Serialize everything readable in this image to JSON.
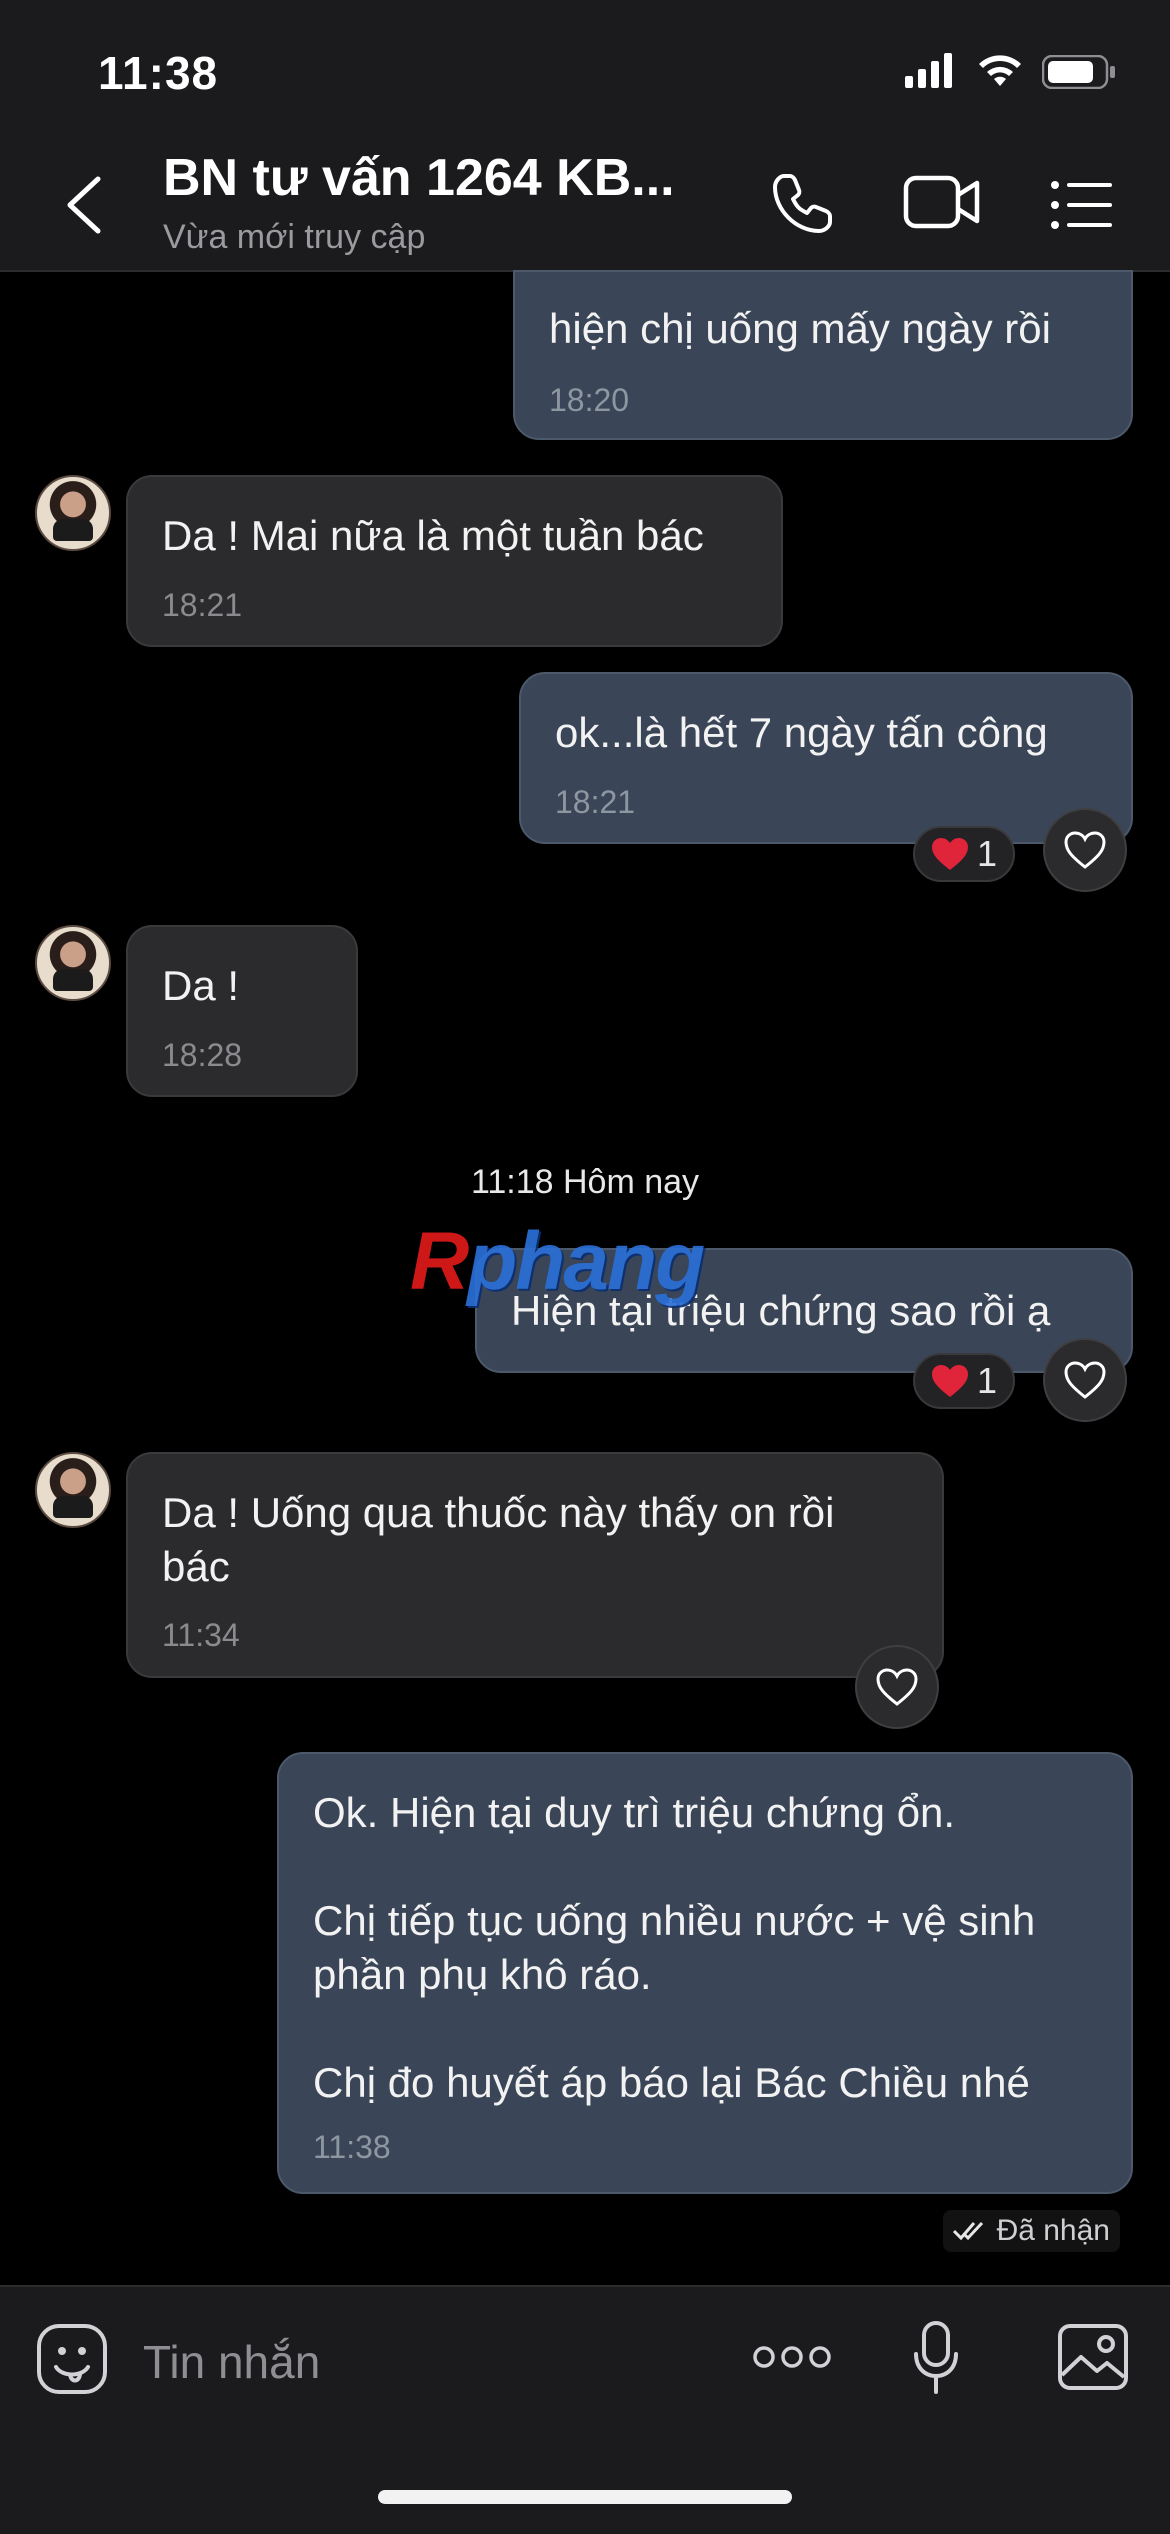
{
  "status_bar": {
    "time": "11:38"
  },
  "header": {
    "title": "BN tư vấn 1264 KB...",
    "subtitle": "Vừa mới truy cập"
  },
  "messages": [
    {
      "direction": "out",
      "text": "hiện chị uống mấy ngày rồi",
      "time": "18:20"
    },
    {
      "direction": "in",
      "text": "Da ! Mai nữa là một tuần bác",
      "time": "18:21"
    },
    {
      "direction": "out",
      "text": "ok...là hết 7 ngày tấn công",
      "time": "18:21",
      "reaction_count": "1"
    },
    {
      "direction": "in",
      "text": "Da !",
      "time": "18:28"
    },
    {
      "direction": "out",
      "text": "Hiện tại triệu chứng sao rồi ạ",
      "reaction_count": "1"
    },
    {
      "direction": "in",
      "text": "Da ! Uống qua thuốc này thấy on rồi\nbác",
      "time": "11:34"
    },
    {
      "direction": "out",
      "text": "Ok. Hiện tại duy trì triệu chứng ổn.\n\nChị tiếp tục uống nhiều nước + vệ sinh\nphần phụ khô ráo.\n\nChị đo huyết áp báo lại Bác Chiều nhé",
      "time": "11:38"
    }
  ],
  "date_divider": "11:18 Hôm nay",
  "watermark": {
    "first": "R",
    "rest": "phang"
  },
  "delivery_status": "Đã nhận",
  "composer": {
    "placeholder": "Tin nhắn"
  },
  "colors": {
    "outgoing_bubble": "#3a4657",
    "incoming_bubble": "#2b2b2d",
    "reaction_heart": "#e0243a"
  }
}
